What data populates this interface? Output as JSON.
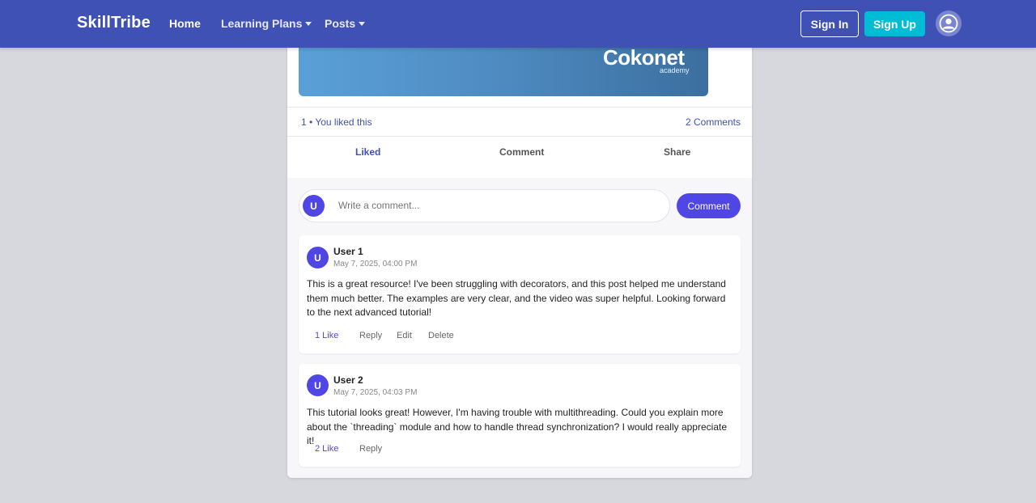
{
  "nav": {
    "brand": "SkillTribe",
    "home": "Home",
    "learning_plans": "Learning Plans",
    "posts": "Posts",
    "sign_in": "Sign In",
    "sign_up": "Sign Up"
  },
  "post": {
    "banner_logo": "Cokonet",
    "banner_sub": "academy",
    "likes_text": "1 • You liked this",
    "comments_count": "2 Comments",
    "actions": {
      "liked": "Liked",
      "comment": "Comment",
      "share": "Share"
    }
  },
  "comment_box": {
    "avatar_initial": "U",
    "placeholder": "Write a comment...",
    "submit": "Comment"
  },
  "comments": [
    {
      "initial": "U",
      "user": "User 1",
      "date": "May 7, 2025, 04:00 PM",
      "text": "This is a great resource! I've been struggling with decorators, and this post helped me understand them much better. The examples are very clear, and the video was super helpful. Looking forward to the next advanced tutorial!",
      "like": "1 Like",
      "reply": "Reply",
      "edit": "Edit",
      "delete": "Delete"
    },
    {
      "initial": "U",
      "user": "User 2",
      "date": "May 7, 2025, 04:03 PM",
      "text": "This tutorial looks great! However, I'm having trouble with multithreading. Could you explain more about the `threading` module and how to handle thread synchronization? I would really appreciate it!",
      "like": "2 Like",
      "reply": "Reply"
    }
  ],
  "colors": {
    "nav_bg": "#3f51b5",
    "accent": "#4f46e5",
    "signup_bg": "#00bcd4",
    "page_bg": "#d7d8dd"
  }
}
